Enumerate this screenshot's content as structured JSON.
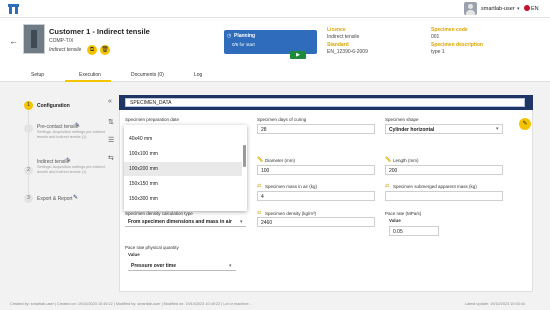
{
  "topbar": {
    "user_name": "smartlab-user",
    "language": "EN"
  },
  "header": {
    "back": "←",
    "title": "Customer 1 - Indirect tensile",
    "subtitle": "COMP-T/X",
    "type_label": "Indirect tensile",
    "copy_icon": "copy-icon",
    "delete_icon": "trash-icon",
    "status": {
      "label": "Planning",
      "detail": "0/6 for start",
      "clock": "◷"
    },
    "play": "▶",
    "info": [
      {
        "label": "Licence",
        "value": "Indirect tensile"
      },
      {
        "label": "Specimen code",
        "value": "001"
      },
      {
        "label": "Standard",
        "value": "EN_12390-6-2009"
      },
      {
        "label": "Specimen description",
        "value": "type 1"
      }
    ]
  },
  "tabs": [
    "Setup",
    "Execution",
    "Documents (0)",
    "Log"
  ],
  "active_tab": "Execution",
  "sidebar": {
    "collapse": "«",
    "tool1": "⇅",
    "tool2": "☰",
    "tool3": "⇆",
    "steps": [
      {
        "num": "1",
        "title": "Configuration",
        "desc": ""
      },
      {
        "num": "",
        "title": "Pre-contact tensile",
        "desc": "Settings: Acquisition settings pre-indirect tensile and indirect tensile (1)"
      },
      {
        "num": "2",
        "title": "Indirect tensile",
        "desc": "Settings: Acquisition settings pre-indirect tensile and indirect tensile (1)"
      },
      {
        "num": "3",
        "title": "Export & Report",
        "desc": ""
      }
    ]
  },
  "main": {
    "section_title": "SPECIMEN_DATA",
    "fields": {
      "prep_date_label": "Specimen preparation date",
      "days_curing_label": "Specimen days of curing",
      "days_curing_value": "28",
      "shape_label": "Specimen shape",
      "shape_value": "Cylinder horizontal",
      "diameter_label": "Diameter (mm)",
      "diameter_value": "100",
      "length_label": "Length (mm)",
      "length_value": "200",
      "mass_air_label": "Specimen mass in air (kg)",
      "mass_air_value": "4",
      "submerged_label": "Specimen submerged apparent mass (kg)",
      "submerged_value": "",
      "density_calc_label": "Specimen density calculation type",
      "density_calc_value": "From specimen dimensions and mass in air",
      "density_label": "Specimen density (kg/m³)",
      "density_value": "2460",
      "pace_rate_label": "Pace rate (MPa/s)",
      "pace_rate_sub": "Value",
      "pace_rate_value": "0.05",
      "pace_phys_label": "Pace rate physical quantity",
      "pace_phys_sub": "Value",
      "pace_phys_value": "Pressure over time"
    },
    "dropdown_options": [
      "40x40 mm",
      "100x100 mm",
      "100x200 mm",
      "150x150 mm",
      "150x300 mm"
    ],
    "dropdown_selected": "100x200 mm",
    "save_icon": "save-icon"
  },
  "footer": {
    "left": "Created by: smartlab-user | Created on: 19/10/2023 10:49:22 | Modified by: smartlab-user | Modified on: 19/10/2023 10:49:22 | Lot or machine: -",
    "right": "Latest update: 19/10/2023 10:53:44"
  },
  "colors": {
    "accent": "#f5c400",
    "section_bar": "#1e3566",
    "planning": "#2f6dbc",
    "play": "#1e8c3b"
  }
}
